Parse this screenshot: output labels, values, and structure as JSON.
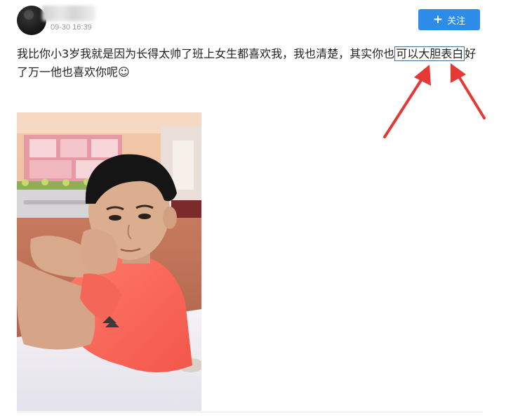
{
  "post": {
    "time": "09-30 16:39",
    "follow_label": "关注",
    "text_before": "我比你小3岁我就是因为长得太帅了班上女生都喜欢我，我也清楚，其实你也",
    "text_highlight": "可以大胆表白",
    "text_after": "好了万一他也喜欢你呢☺"
  },
  "colors": {
    "follow_button": "#2d8ce8",
    "arrow": "#e53935",
    "highlight_border": "#4a6f8f"
  }
}
